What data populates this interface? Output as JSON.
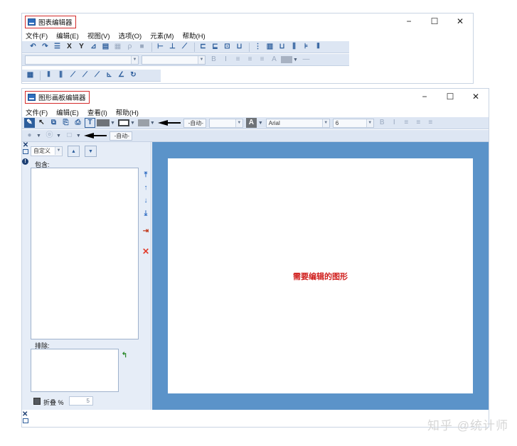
{
  "chart_editor": {
    "title": "图表编辑器",
    "controls": {
      "minimize": "−",
      "maximize": "☐",
      "close": "✕"
    },
    "menu": [
      "文件(F)",
      "编辑(E)",
      "视图(V)",
      "选项(O)",
      "元素(M)",
      "帮助(H)"
    ],
    "font_size_letters": {
      "bold": "B",
      "italic": "I",
      "font_letter": "A"
    }
  },
  "graph_editor": {
    "title": "图形画板编辑器",
    "controls": {
      "minimize": "−",
      "maximize": "☐",
      "close": "✕"
    },
    "menu": [
      "文件(F)",
      "编辑(E)",
      "查看(I)",
      "帮助(H)"
    ],
    "line_style_auto": "-自动-",
    "font_combo": "Arial",
    "font_size": "6",
    "bold": "B",
    "italic": "I",
    "second_row_auto": "-自动-",
    "panel": {
      "dropdown_value": "自定义",
      "include_label": "包含:",
      "exclude_label": "排除:",
      "fold_label": "折叠 %",
      "fold_value": "5"
    },
    "canvas_text": "需要编辑的图形"
  },
  "watermark": "知乎 @统计师",
  "colors": {
    "accent": "#2d5e9c",
    "toolbar_bg": "#dde6f3",
    "canvas_frame": "#5b93c9",
    "title_box_border": "#d32a2a",
    "canvas_text": "#d0201e"
  },
  "icons": {
    "undo": "↶",
    "redo": "↷",
    "cross": "✕",
    "pencil": "✎",
    "cursor": "↖"
  }
}
